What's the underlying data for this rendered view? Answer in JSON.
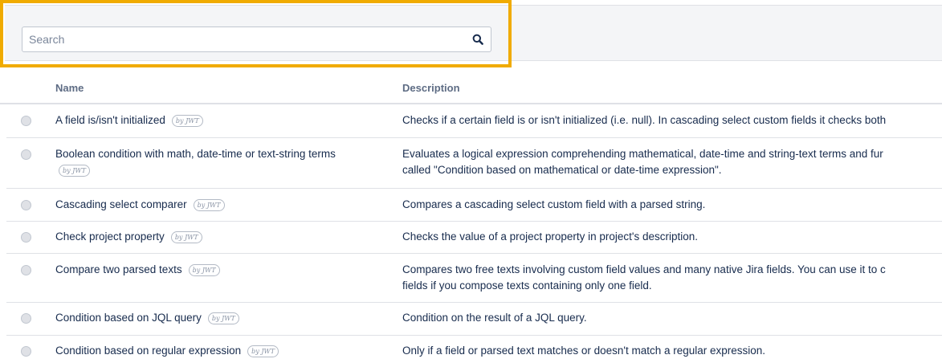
{
  "search": {
    "placeholder": "Search"
  },
  "table": {
    "headers": {
      "name": "Name",
      "description": "Description"
    },
    "badge_text": "by JWT",
    "rows": [
      {
        "name": "A field is/isn't initialized",
        "description": [
          "Checks if a certain field is or isn't initialized (i.e. null). In cascading select custom fields it checks both"
        ]
      },
      {
        "name": "Boolean condition with math, date-time or text-string terms",
        "description": [
          "Evaluates a logical expression comprehending mathematical, date-time and string-text terms and fur",
          "called \"Condition based on mathematical or date-time expression\"."
        ]
      },
      {
        "name": "Cascading select comparer",
        "description": [
          "Compares a cascading select custom field with a parsed string."
        ]
      },
      {
        "name": "Check project property",
        "description": [
          "Checks the value of a project property in project's description."
        ]
      },
      {
        "name": "Compare two parsed texts",
        "description": [
          "Compares two free texts involving custom field values and many native Jira fields. You can use it to c",
          "fields if you compose texts containing only one field."
        ]
      },
      {
        "name": "Condition based on JQL query",
        "description": [
          "Condition on the result of a JQL query."
        ]
      },
      {
        "name": "Condition based on regular expression",
        "description": [
          "Only if a field or parsed text matches or doesn't match a regular expression."
        ]
      }
    ]
  },
  "colors": {
    "highlight": "#f0ab00",
    "toolbar_bg": "#f4f5f7",
    "text": "#172b4d",
    "header_text": "#5e6c84"
  }
}
